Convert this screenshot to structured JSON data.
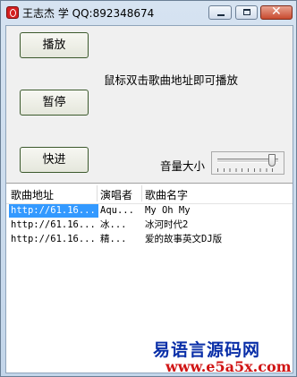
{
  "window": {
    "title": "王志杰 学 QQ:892348674"
  },
  "controls": {
    "play_label": "播放",
    "pause_label": "暂停",
    "fast_label": "快进",
    "hint": "鼠标双击歌曲地址即可播放",
    "volume_label": "音量大小",
    "volume_level": 0.9
  },
  "list": {
    "columns": [
      "歌曲地址",
      "演唱者",
      "歌曲名字"
    ],
    "rows": [
      {
        "url": "http://61.16...",
        "singer": "Aqu...",
        "name": "My Oh My",
        "selected": true
      },
      {
        "url": "http://61.16...",
        "singer": "冰...",
        "name": "冰河时代2",
        "selected": false
      },
      {
        "url": "http://61.16...",
        "singer": "精...",
        "name": "爱的故事英文DJ版",
        "selected": false
      }
    ]
  },
  "watermark": {
    "line1": "易语言源码网",
    "line2": "www.e5a5x.com"
  },
  "colors": {
    "selection": "#3399ff",
    "watermark_blue": "#0a2fa8",
    "watermark_red": "#d01515"
  }
}
